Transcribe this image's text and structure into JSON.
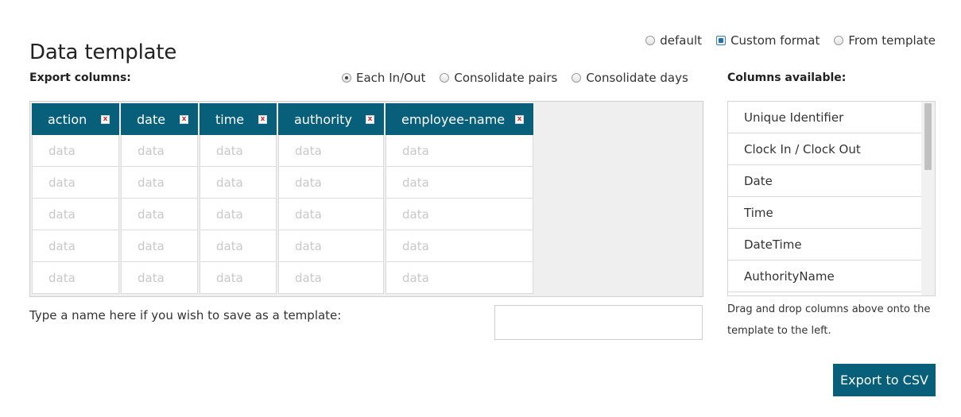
{
  "page": {
    "title": "Data template"
  },
  "format": {
    "options": [
      {
        "label": "default",
        "selected": false
      },
      {
        "label": "Custom format",
        "selected": true
      },
      {
        "label": "From template",
        "selected": false
      }
    ]
  },
  "export_columns": {
    "label": "Export columns:",
    "modes": [
      {
        "label": "Each In/Out",
        "selected": true
      },
      {
        "label": "Consolidate pairs",
        "selected": false
      },
      {
        "label": "Consolidate days",
        "selected": false
      }
    ],
    "remove_glyph": "x",
    "columns": [
      {
        "name": "action",
        "cells": [
          "data",
          "data",
          "data",
          "data",
          "data"
        ]
      },
      {
        "name": "date",
        "cells": [
          "data",
          "data",
          "data",
          "data",
          "data"
        ]
      },
      {
        "name": "time",
        "cells": [
          "data",
          "data",
          "data",
          "data",
          "data"
        ]
      },
      {
        "name": "authority",
        "cells": [
          "data",
          "data",
          "data",
          "data",
          "data"
        ]
      },
      {
        "name": "employee-name",
        "cells": [
          "data",
          "data",
          "data",
          "data",
          "data"
        ]
      }
    ]
  },
  "columns_available": {
    "label": "Columns available:",
    "items": [
      "Unique Identifier",
      "Clock In / Clock Out",
      "Date",
      "Time",
      "DateTime",
      "AuthorityName"
    ],
    "hint": "Drag and drop columns above onto the template to the left."
  },
  "save_template": {
    "label": "Type a name here if you wish to save as a template:",
    "value": "",
    "placeholder": ""
  },
  "actions": {
    "export_label": "Export to CSV"
  },
  "colors": {
    "accent": "#075f7a",
    "placeholder_text": "#c8c8c8"
  }
}
